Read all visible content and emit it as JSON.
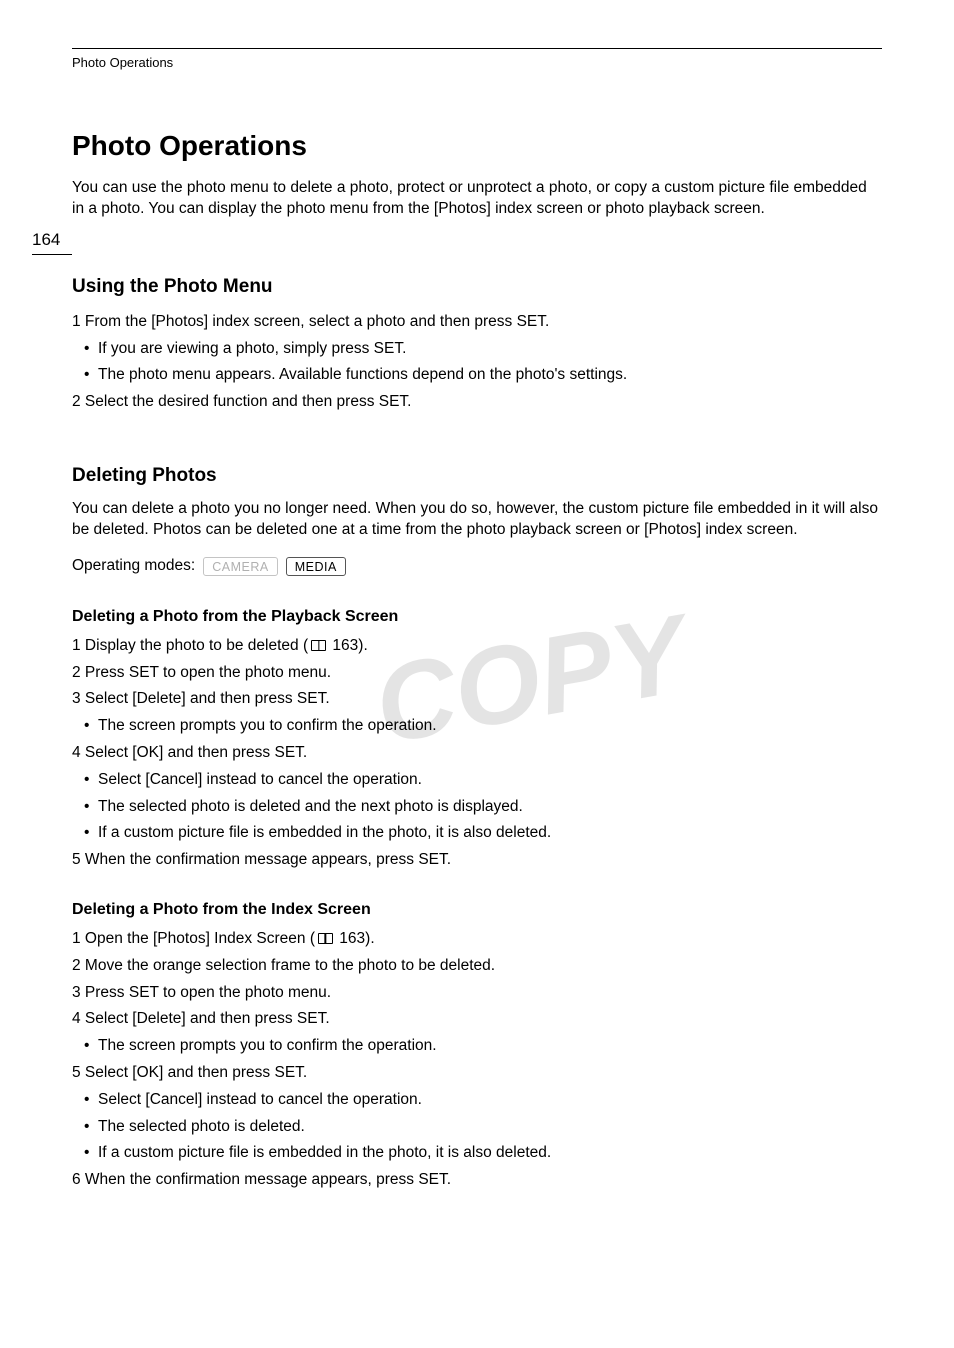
{
  "header": {
    "chapter": "Photo Operations",
    "page_number": "164"
  },
  "title": "Photo Operations",
  "intro": "You can use the photo menu to delete a photo, protect or unprotect a photo, or copy a custom picture file embedded in a photo. You can display the photo menu from the [Photos] index screen or photo playback screen.",
  "section_menu": {
    "heading": "Using the Photo Menu",
    "step1": "1 From the [Photos] index screen, select a photo and then press SET.",
    "b1": "If you are viewing a photo, simply press SET.",
    "b2": "The photo menu appears. Available functions depend on the photo's settings.",
    "step2": "2 Select the desired function and then press SET."
  },
  "section_delete": {
    "heading": "Deleting Photos",
    "intro": "You can delete a photo you no longer need. When you do so, however, the custom picture file embedded in it will also be deleted. Photos can be deleted one at a time from the photo playback screen or [Photos] index screen.",
    "modes_label": "Operating modes:",
    "mode_camera": "CAMERA",
    "mode_media": "MEDIA",
    "playback": {
      "heading": "Deleting a Photo from the Playback Screen",
      "s1a": "1 Display the photo to be deleted (",
      "s1b": " 163).",
      "s2": "2 Press SET to open the photo menu.",
      "s3": "3 Select [Delete] and then press SET.",
      "s3b1": "The screen prompts you to confirm the operation.",
      "s4": "4 Select [OK] and then press SET.",
      "s4b1": "Select [Cancel] instead to cancel the operation.",
      "s4b2": "The selected photo is deleted and the next photo is displayed.",
      "s4b3": "If a custom picture file is embedded in the photo, it is also deleted.",
      "s5": "5 When the confirmation message appears, press SET."
    },
    "index": {
      "heading": "Deleting a Photo from the Index Screen",
      "s1a": "1 Open the [Photos] Index Screen (",
      "s1b": " 163).",
      "s2": "2 Move the orange selection frame to the photo to be deleted.",
      "s3": "3 Press SET to open the photo menu.",
      "s4": "4 Select [Delete] and then press SET.",
      "s4b1": "The screen prompts you to confirm the operation.",
      "s5": "5 Select [OK] and then press SET.",
      "s5b1": "Select [Cancel] instead to cancel the operation.",
      "s5b2": "The selected photo is deleted.",
      "s5b3": "If a custom picture file is embedded in the photo, it is also deleted.",
      "s6": "6 When the confirmation message appears, press SET."
    }
  },
  "watermark_text": "COPY"
}
